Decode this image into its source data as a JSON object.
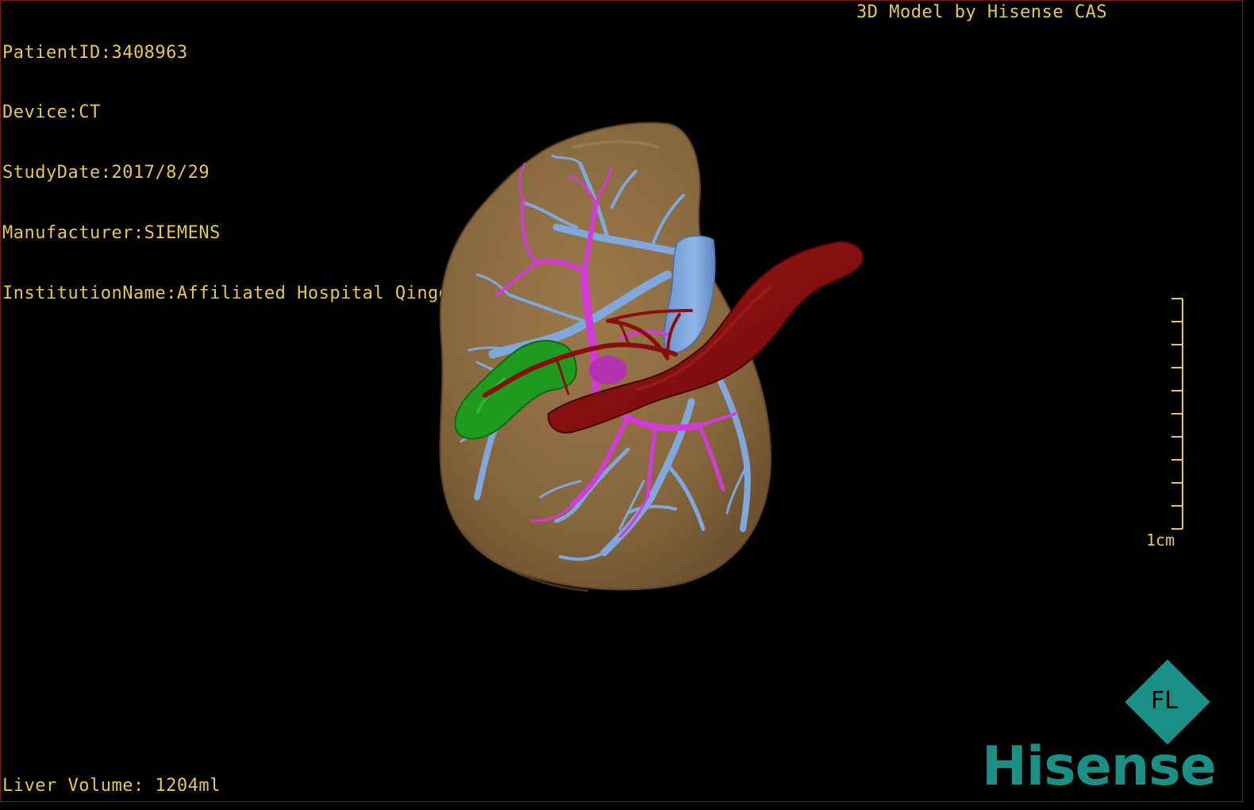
{
  "study_info": {
    "patient_id": "PatientID:3408963",
    "device": "Device:CT",
    "study_date": "StudyDate:2017/8/29",
    "manufacturer": "Manufacturer:SIEMENS",
    "institution": "InstitutionName:Affiliated Hospital Qingdao University-C"
  },
  "model_label": "3D Model by Hisense CAS",
  "liver_volume": "Liver Volume: 1204ml",
  "scale_bar": {
    "label": "1cm"
  },
  "logo": {
    "text": "Hisense",
    "badge_letters": "FL"
  },
  "colors": {
    "text": "#e8c650",
    "liver": "#8a6a40",
    "portal_vein": "#d43ad8",
    "hepatic_vein": "#7fa8df",
    "artery": "#8b0e0e",
    "gallbladder": "#1e9a1e",
    "logo": "#1a8f86"
  }
}
